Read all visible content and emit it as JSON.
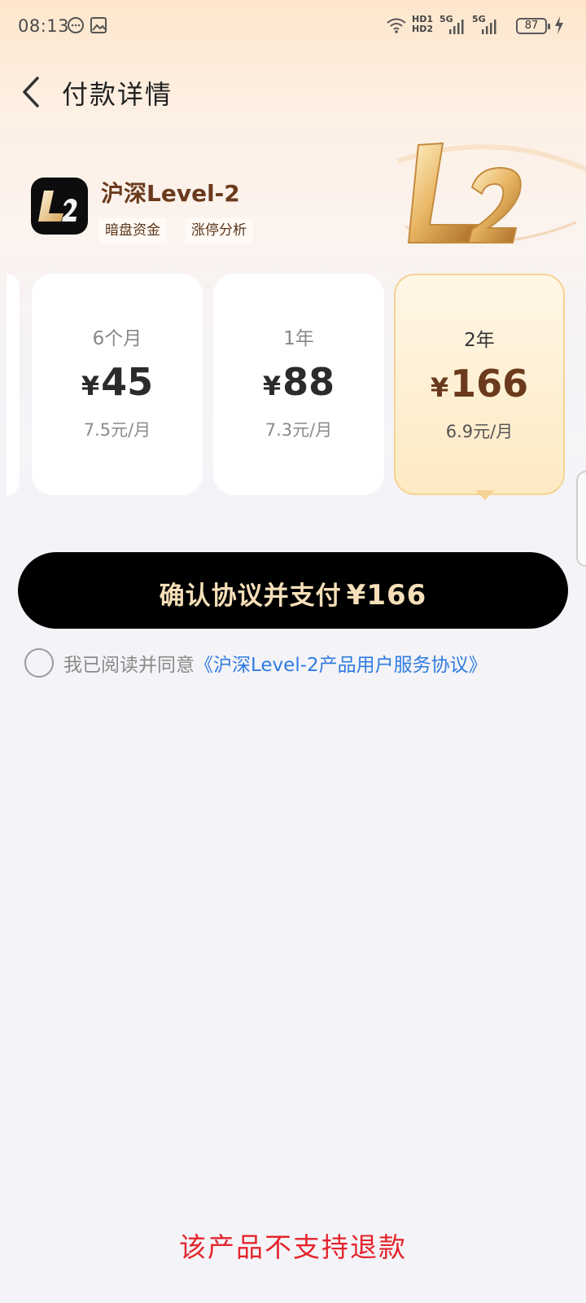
{
  "status_bar": {
    "time": "08:13",
    "battery": "87",
    "network_1": "5G",
    "network_2": "5G",
    "hd_1": "HD1",
    "hd_2": "HD2"
  },
  "header": {
    "title": "付款详情"
  },
  "product": {
    "name": "沪深Level-2",
    "logo_text": "L2",
    "tags": [
      "暗盘资金",
      "涨停分析"
    ]
  },
  "plans": [
    {
      "duration": "6个月",
      "currency": "¥",
      "price": "45",
      "monthly": "7.5元/月",
      "selected": false
    },
    {
      "duration": "1年",
      "currency": "¥",
      "price": "88",
      "monthly": "7.3元/月",
      "selected": false
    },
    {
      "duration": "2年",
      "currency": "¥",
      "price": "166",
      "monthly": "6.9元/月",
      "selected": true
    }
  ],
  "pay_button": {
    "label": "确认协议并支付",
    "amount": "¥166"
  },
  "agreement": {
    "checked": false,
    "prefix": "我已阅读并同意",
    "link_text": "《沪深Level-2产品用户服务协议》"
  },
  "refund_note": "该产品不支持退款",
  "colors": {
    "accent_gold": "#f6dfb8",
    "brand_brown": "#6b3a1c",
    "link_blue": "#2f7be0",
    "warning_red": "#e4252d",
    "selected_border": "#f6d394"
  }
}
